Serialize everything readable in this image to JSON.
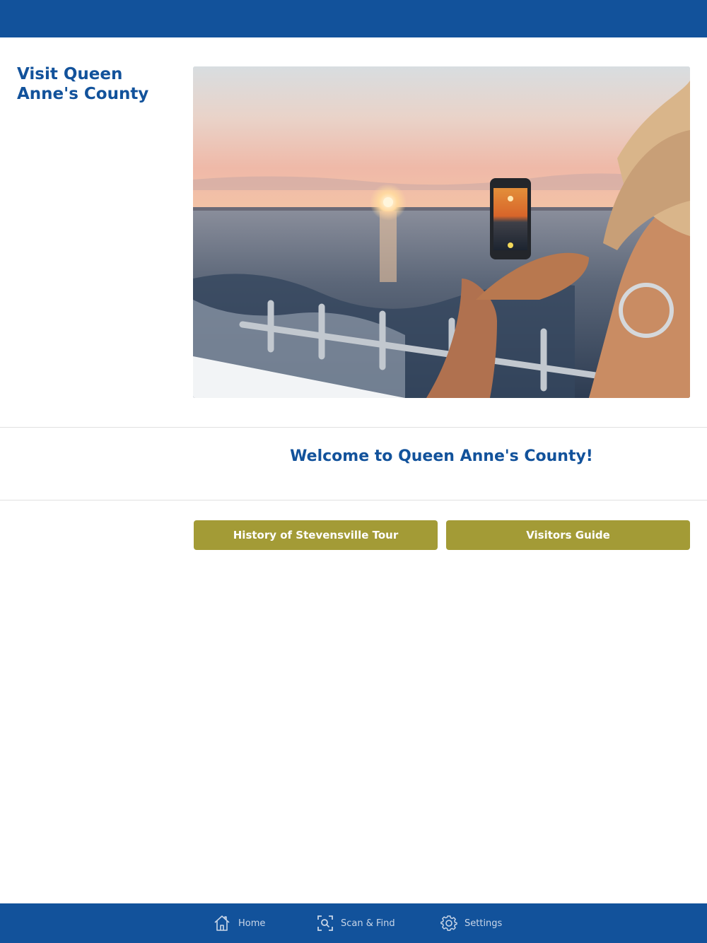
{
  "header": {
    "site_title": "Visit Queen Anne's County"
  },
  "hero": {
    "image": "sunset-phone-photo"
  },
  "main": {
    "welcome": "Welcome to Queen Anne's County!",
    "buttons": [
      {
        "label": "History of Stevensville Tour"
      },
      {
        "label": "Visitors Guide"
      }
    ]
  },
  "tabbar": {
    "items": [
      {
        "label": "Home",
        "icon": "home-icon"
      },
      {
        "label": "Scan & Find",
        "icon": "scan-icon"
      },
      {
        "label": "Settings",
        "icon": "gear-icon"
      }
    ]
  },
  "colors": {
    "brand_blue": "#12529b",
    "button_olive": "#a39b36",
    "tab_text": "#c9d6e8"
  }
}
